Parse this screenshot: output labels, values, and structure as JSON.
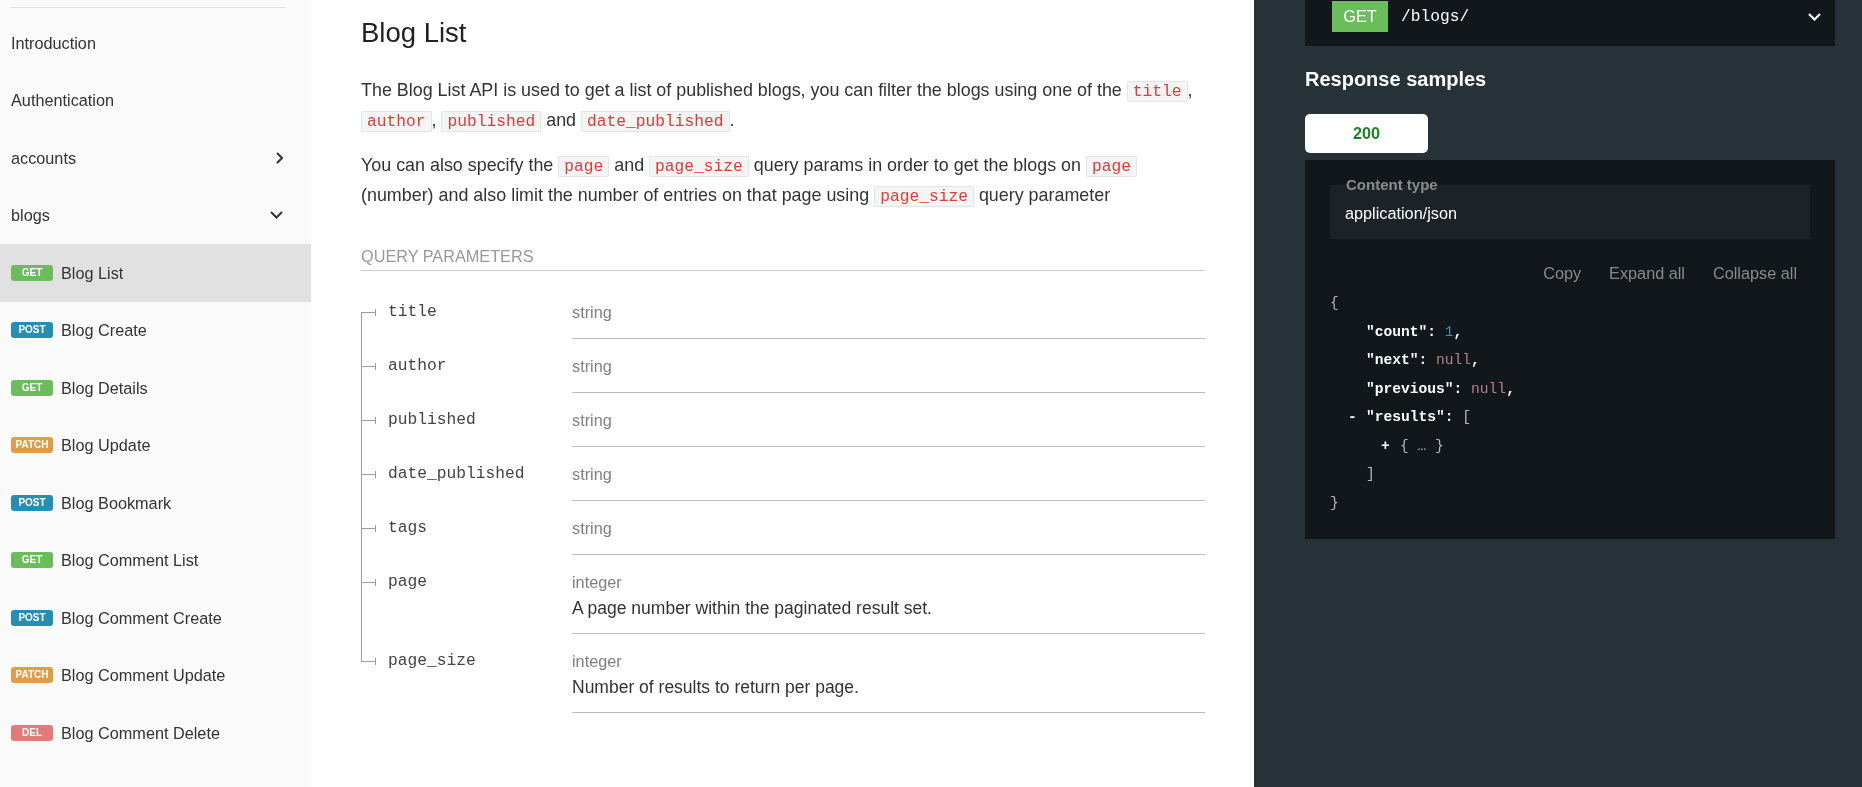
{
  "sidebar": {
    "items": [
      {
        "kind": "link",
        "label": "Introduction"
      },
      {
        "kind": "link",
        "label": "Authentication"
      },
      {
        "kind": "group",
        "label": "accounts",
        "expanded": false
      },
      {
        "kind": "group",
        "label": "blogs",
        "expanded": true,
        "children": [
          {
            "method": "GET",
            "color": "#6bbd5b",
            "label": "Blog List",
            "selected": true
          },
          {
            "method": "POST",
            "color": "#248fb2",
            "label": "Blog Create",
            "selected": false
          },
          {
            "method": "GET",
            "color": "#6bbd5b",
            "label": "Blog Details",
            "selected": false
          },
          {
            "method": "PATCH",
            "color": "#e09d43",
            "label": "Blog Update",
            "selected": false
          },
          {
            "method": "POST",
            "color": "#248fb2",
            "label": "Blog Bookmark",
            "selected": false
          },
          {
            "method": "GET",
            "color": "#6bbd5b",
            "label": "Blog Comment List",
            "selected": false
          },
          {
            "method": "POST",
            "color": "#248fb2",
            "label": "Blog Comment Create",
            "selected": false
          },
          {
            "method": "PATCH",
            "color": "#e09d43",
            "label": "Blog Comment Update",
            "selected": false
          },
          {
            "method": "DEL",
            "color": "#e27a7a",
            "label": "Blog Comment Delete",
            "selected": false
          }
        ]
      }
    ]
  },
  "operation": {
    "title": "Blog List",
    "description": [
      [
        {
          "kind": "text",
          "text": "The Blog List API is used to get a list of published blogs, you can filter the blogs using one of the "
        },
        {
          "kind": "code",
          "text": "title"
        },
        {
          "kind": "text",
          "text": ", "
        },
        {
          "kind": "code",
          "text": "author"
        },
        {
          "kind": "text",
          "text": ", "
        },
        {
          "kind": "code",
          "text": "published"
        },
        {
          "kind": "text",
          "text": " and "
        },
        {
          "kind": "code",
          "text": "date_published"
        },
        {
          "kind": "text",
          "text": "."
        }
      ],
      [
        {
          "kind": "text",
          "text": "You can also specify the "
        },
        {
          "kind": "code",
          "text": "page"
        },
        {
          "kind": "text",
          "text": " and "
        },
        {
          "kind": "code",
          "text": "page_size"
        },
        {
          "kind": "text",
          "text": " query params in order to get the blogs on "
        },
        {
          "kind": "code",
          "text": "page"
        },
        {
          "kind": "text",
          "text": " (number) and also limit the number of entries on that page using "
        },
        {
          "kind": "code",
          "text": "page_size"
        },
        {
          "kind": "text",
          "text": " query parameter"
        }
      ]
    ],
    "parameters_heading": "QUERY PARAMETERS",
    "parameters": [
      {
        "name": "title",
        "type": "string"
      },
      {
        "name": "author",
        "type": "string"
      },
      {
        "name": "published",
        "type": "string"
      },
      {
        "name": "date_published",
        "type": "string"
      },
      {
        "name": "tags",
        "type": "string"
      },
      {
        "name": "page",
        "type": "integer",
        "description": "A page number within the paginated result set."
      },
      {
        "name": "page_size",
        "type": "integer",
        "description": "Number of results to return per page."
      }
    ]
  },
  "right_panel": {
    "endpoint": {
      "method": "GET",
      "path": "/blogs/"
    },
    "heading": "Response samples",
    "tabs": [
      {
        "label": "200",
        "selected": true
      }
    ],
    "content_type": {
      "label": "Content type",
      "value": "application/json"
    },
    "actions": [
      "Copy",
      "Expand all",
      "Collapse all"
    ],
    "sample": {
      "open": "{",
      "close": "}",
      "entries": [
        {
          "kind": "number",
          "key": "\"count\"",
          "colon": ": ",
          "value": "1",
          "comma": ","
        },
        {
          "kind": "null",
          "key": "\"next\"",
          "colon": ": ",
          "value": "null",
          "comma": ","
        },
        {
          "kind": "null",
          "key": "\"previous\"",
          "colon": ": ",
          "value": "null",
          "comma": ","
        },
        {
          "kind": "array",
          "toggle": "-",
          "key": "\"results\"",
          "colon": ": ",
          "open": "[",
          "close": "]",
          "items": [
            {
              "toggle": "+",
              "text": "{ … }"
            }
          ]
        }
      ]
    }
  }
}
